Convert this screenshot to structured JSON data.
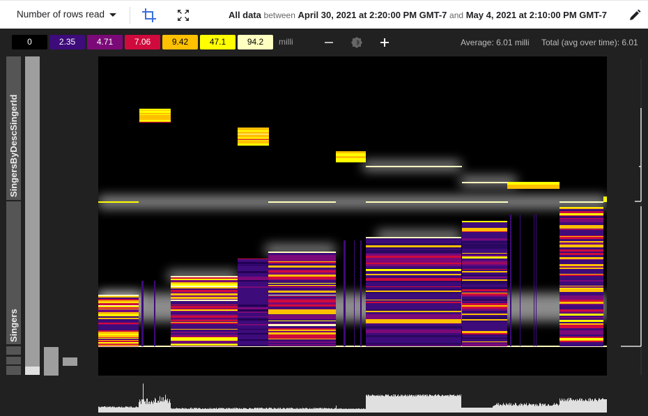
{
  "toolbar": {
    "metric_label": "Number of rows read",
    "crop_icon": "crop-icon",
    "fullscreen_icon": "fullscreen-icon",
    "range": {
      "prefix": "All data",
      "between": "between",
      "start": "April 30, 2021 at 2:20:00 PM GMT-7",
      "and": "and",
      "end": "May 4, 2021 at 2:10:00 PM GMT-7"
    },
    "edit_icon": "pencil-icon"
  },
  "legend": {
    "chips": [
      {
        "label": "0",
        "bg": "#000000",
        "fg": "#ffffff"
      },
      {
        "label": "2.35",
        "bg": "#3d0b7a",
        "fg": "#ffffff"
      },
      {
        "label": "4.71",
        "bg": "#7b0a78",
        "fg": "#ffffff"
      },
      {
        "label": "7.06",
        "bg": "#d00a3c",
        "fg": "#ffffff"
      },
      {
        "label": "9.42",
        "bg": "#ffc000",
        "fg": "#000000"
      },
      {
        "label": "47.1",
        "bg": "#ffff00",
        "fg": "#000000"
      },
      {
        "label": "94.2",
        "bg": "#ffffc0",
        "fg": "#000000"
      }
    ],
    "unit": "milli",
    "zoom_out_icon": "minus-icon",
    "brightness_icon": "brightness-icon",
    "zoom_in_icon": "plus-icon",
    "average": "Average: 6.01 milli",
    "total": "Total (avg over time): 6.01"
  },
  "keys": {
    "tables": [
      {
        "label": "SingersByDescSingerId"
      },
      {
        "label": "Singers"
      }
    ]
  },
  "heatmap": {
    "colors": {
      "background": "#000000",
      "dark_purple": "#3d0b7a",
      "purple": "#7b0a78",
      "red": "#d00a3c",
      "orange": "#ffc000",
      "yellow": "#ffff00",
      "pale": "#ffffc0"
    }
  }
}
